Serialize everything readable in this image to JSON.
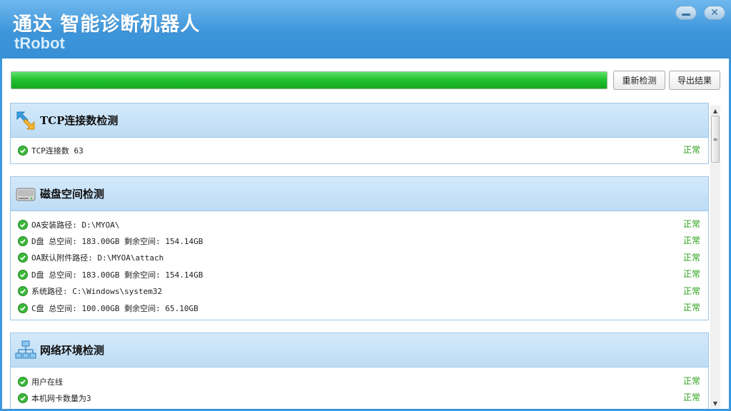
{
  "window": {
    "title": "通达 智能诊断机器人",
    "subtitle": "tRobot",
    "minimize_icon": "minimize-icon",
    "close_icon": "close-icon",
    "close_glyph": "✕"
  },
  "toolbar": {
    "progress_fraction": 1.0,
    "recheck_label": "重新检测",
    "export_label": "导出结果"
  },
  "sections": [
    {
      "title": "TCP连接数检测",
      "icon": "arrows-icon",
      "rows": [
        {
          "text": "TCP连接数 63",
          "status": "正常"
        }
      ]
    },
    {
      "title": "磁盘空间检测",
      "icon": "disk-icon",
      "rows": [
        {
          "text": "OA安装路径: D:\\MYOA\\",
          "status": "正常"
        },
        {
          "text": "D盘 总空间: 183.00GB 剩余空间: 154.14GB",
          "status": "正常"
        },
        {
          "text": "OA默认附件路径: D:\\MYOA\\attach",
          "status": "正常"
        },
        {
          "text": "D盘 总空间: 183.00GB 剩余空间: 154.14GB",
          "status": "正常"
        },
        {
          "text": "系统路径: C:\\Windows\\system32",
          "status": "正常"
        },
        {
          "text": "C盘 总空间: 100.00GB 剩余空间: 65.10GB",
          "status": "正常"
        }
      ]
    },
    {
      "title": "网络环境检测",
      "icon": "network-icon",
      "rows": [
        {
          "text": "用户在线",
          "status": "正常"
        },
        {
          "text": "本机网卡数量为3",
          "status": "正常"
        }
      ]
    }
  ],
  "scrollbar": {
    "up_glyph": "▲",
    "down_glyph": "▼",
    "grip_glyph": "≡"
  },
  "colors": {
    "titlebar": "#3d95da",
    "progress": "#22c22f",
    "status_ok": "#2aa11a",
    "section_header": "#c8e2f7"
  }
}
